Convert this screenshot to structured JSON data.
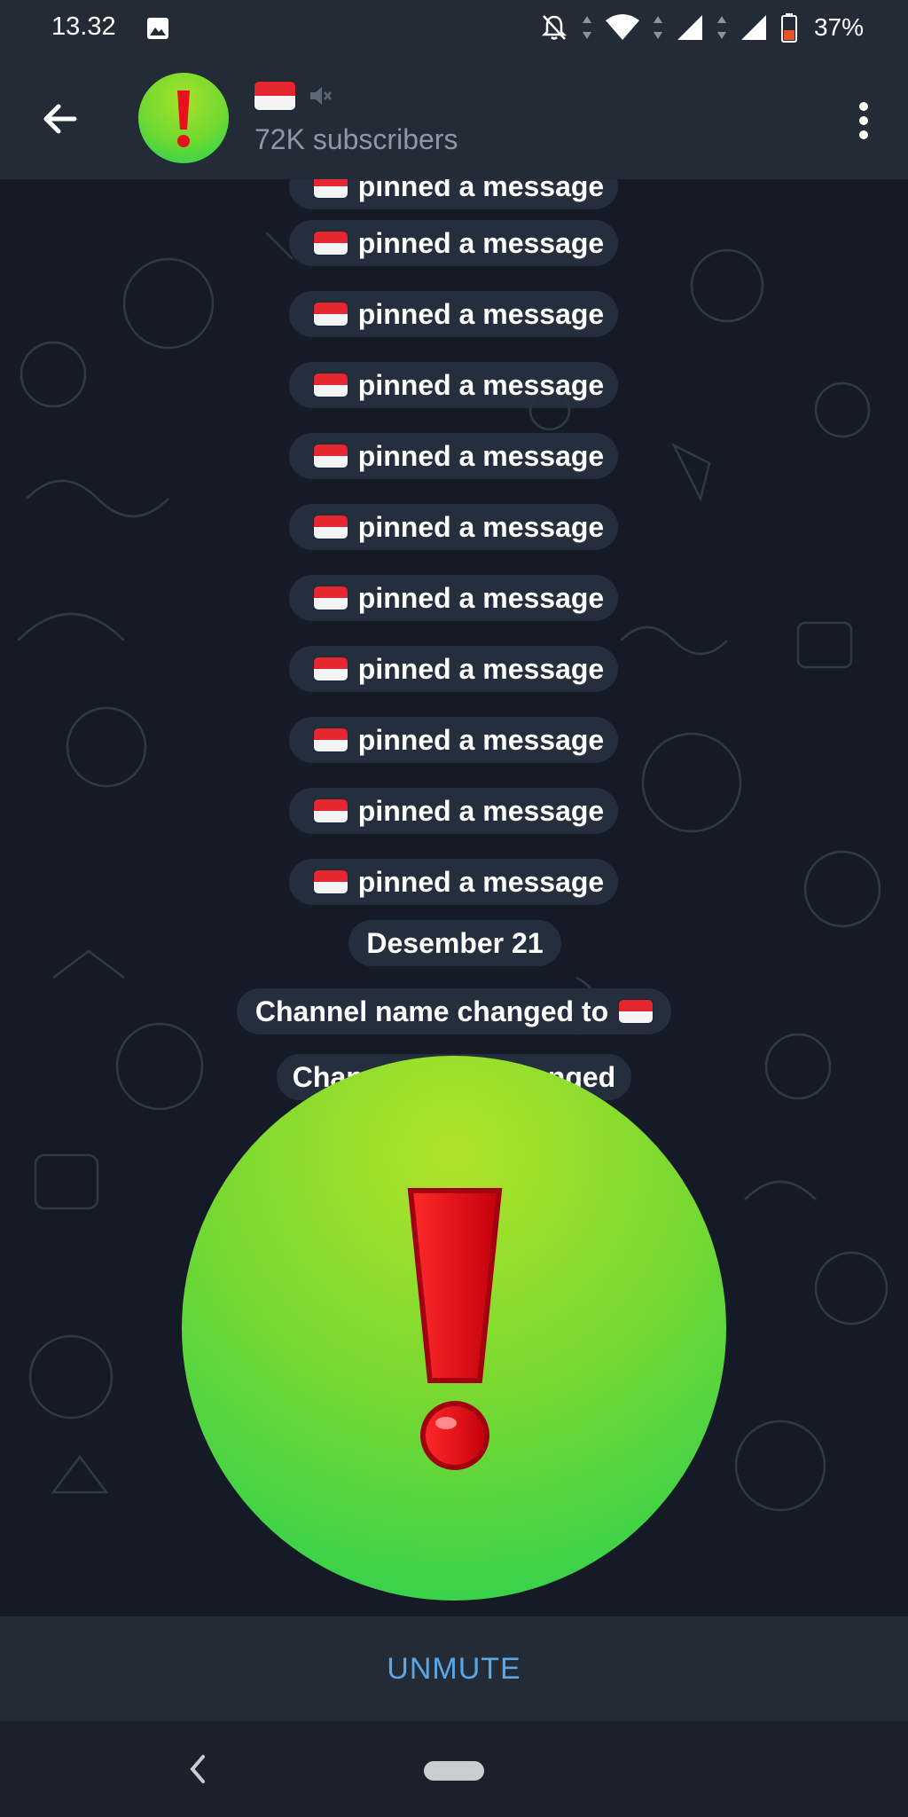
{
  "status_bar": {
    "time": "13.32",
    "battery": "37%",
    "icons": [
      "image-icon",
      "notifications-off-icon",
      "wifi-icon",
      "signal-icon",
      "signal-icon",
      "battery-icon"
    ]
  },
  "header": {
    "channel_name_flag": "indonesia-flag-emoji",
    "muted_icon": "speaker-muted-icon",
    "subtitle": "72K subscribers"
  },
  "messages": {
    "pinned_text": "pinned a message",
    "pinned_items": [
      {
        "text": "pinned a message"
      },
      {
        "text": "pinned a message"
      },
      {
        "text": "pinned a message"
      },
      {
        "text": "pinned a message"
      },
      {
        "text": "pinned a message"
      },
      {
        "text": "pinned a message"
      },
      {
        "text": "pinned a message"
      },
      {
        "text": "pinned a message"
      },
      {
        "text": "pinned a message"
      },
      {
        "text": "pinned a message"
      }
    ],
    "date_separator": "Desember 21",
    "name_changed": "Channel name changed to",
    "photo_changed": "Channel photo changed"
  },
  "bottom": {
    "unmute_label": "UNMUTE"
  },
  "colors": {
    "bar_bg": "#232b37",
    "chat_bg": "#141b26",
    "accent": "#5aa7e6",
    "avatar_green": "#6fd930",
    "exclamation_red": "#e8101a"
  }
}
